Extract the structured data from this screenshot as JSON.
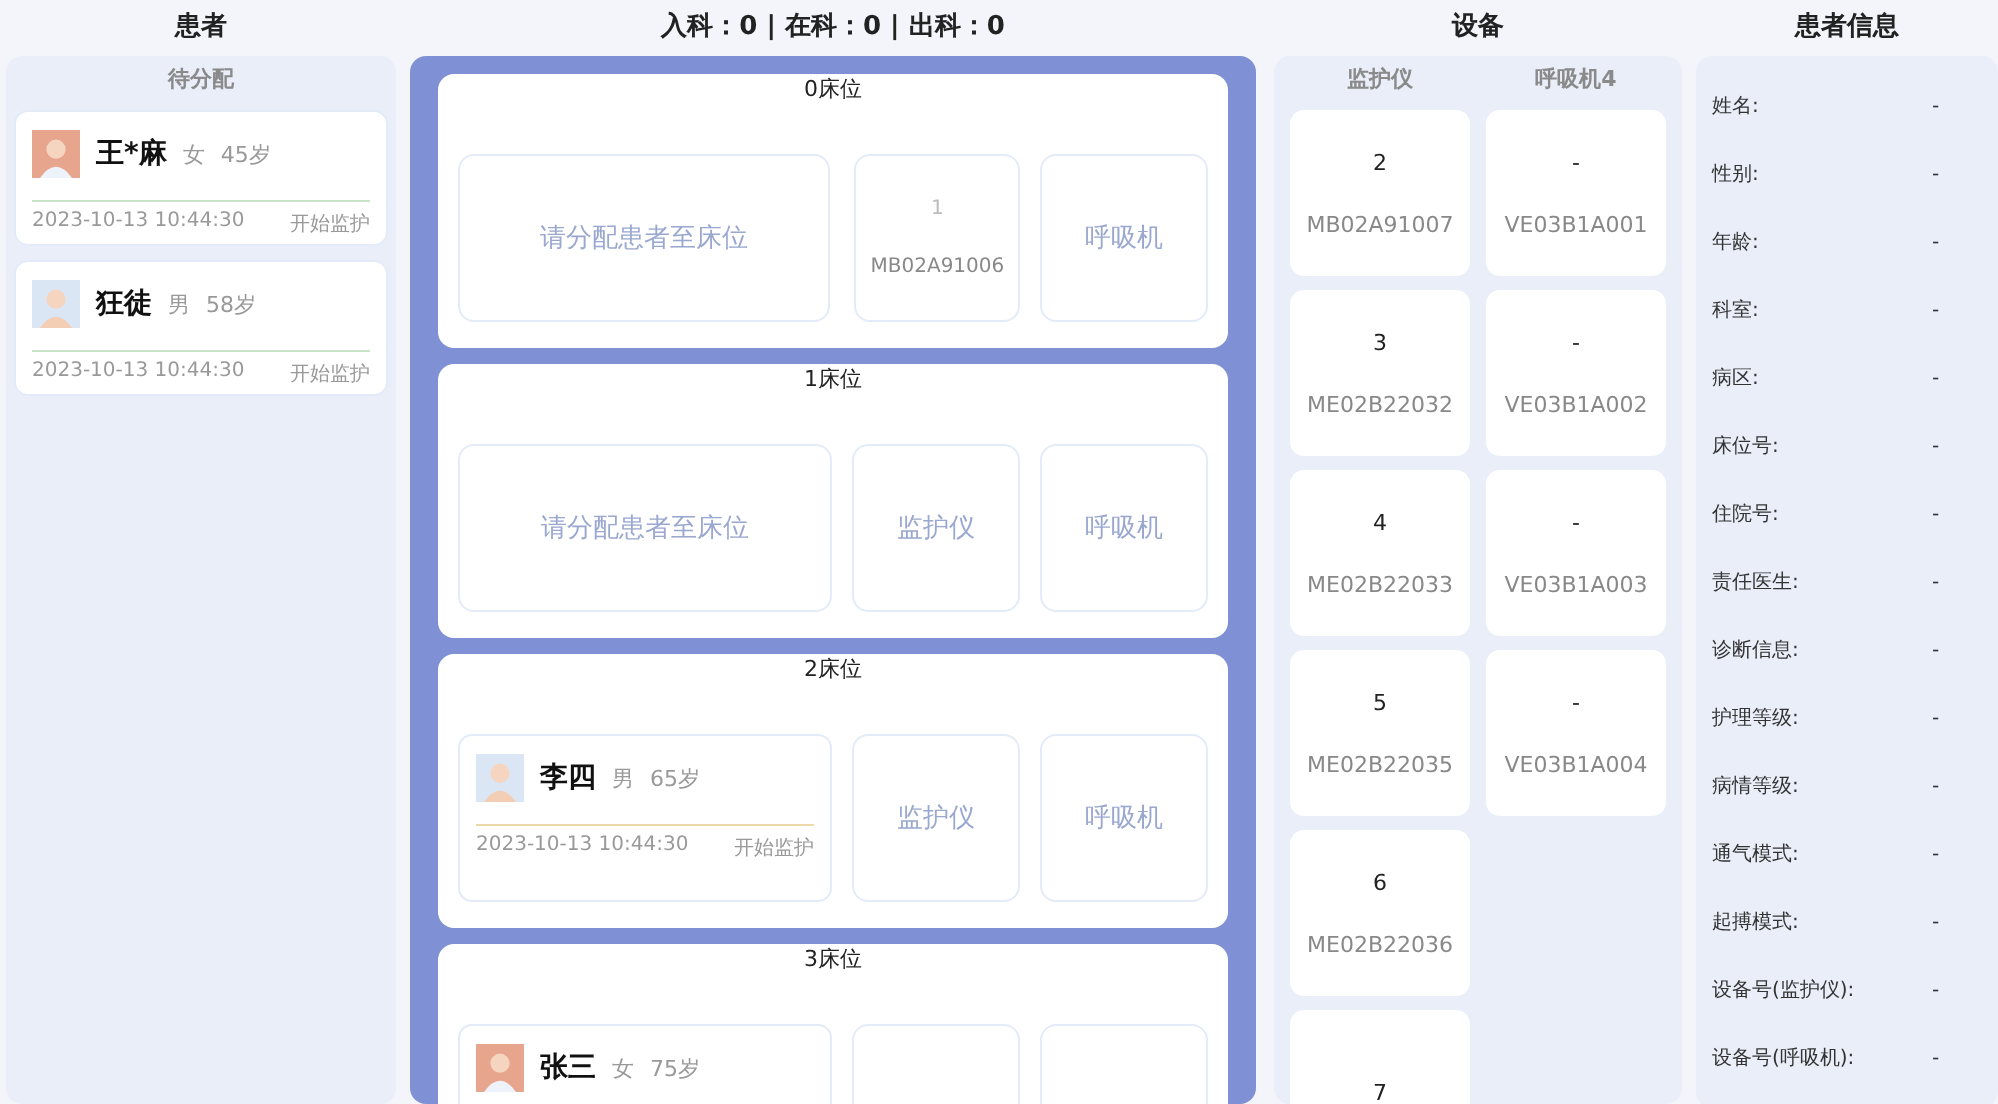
{
  "patients_panel": {
    "title": "患者",
    "subtitle": "待分配",
    "patients": [
      {
        "name": "王*麻",
        "gender": "女",
        "age": "45岁",
        "time": "2023-10-13 10:44:30",
        "action": "开始监护"
      },
      {
        "name": "狂徒",
        "gender": "男",
        "age": "58岁",
        "time": "2023-10-13 10:44:30",
        "action": "开始监护"
      }
    ]
  },
  "beds_panel": {
    "title": "入科：0 | 在科：0 | 出科：0",
    "beds": [
      {
        "label": "0床位",
        "patient": {
          "kind": "placeholder",
          "text": "请分配患者至床位"
        },
        "monitor": {
          "kind": "device",
          "number": "1",
          "serial": "MB02A91006"
        },
        "ventilator": {
          "kind": "empty",
          "text": "呼吸机"
        }
      },
      {
        "label": "1床位",
        "patient": {
          "kind": "placeholder",
          "text": "请分配患者至床位"
        },
        "monitor": {
          "kind": "empty",
          "text": "监护仪"
        },
        "ventilator": {
          "kind": "empty",
          "text": "呼吸机"
        }
      },
      {
        "label": "2床位",
        "patient": {
          "kind": "patient",
          "name": "李四",
          "gender": "男",
          "age": "65岁",
          "time": "2023-10-13 10:44:30",
          "action": "开始监护"
        },
        "monitor": {
          "kind": "empty",
          "text": "监护仪"
        },
        "ventilator": {
          "kind": "empty",
          "text": "呼吸机"
        }
      },
      {
        "label": "3床位",
        "patient": {
          "kind": "patient",
          "name": "张三",
          "gender": "女",
          "age": "75岁"
        },
        "monitor": {
          "kind": "blank"
        },
        "ventilator": {
          "kind": "blank"
        }
      }
    ]
  },
  "devices_panel": {
    "title": "设备",
    "columns": [
      "监护仪",
      "呼吸机4"
    ],
    "monitors": [
      {
        "number": "2",
        "serial": "MB02A91007"
      },
      {
        "number": "3",
        "serial": "ME02B22032"
      },
      {
        "number": "4",
        "serial": "ME02B22033"
      },
      {
        "number": "5",
        "serial": "ME02B22035"
      },
      {
        "number": "6",
        "serial": "ME02B22036"
      },
      {
        "number": "7"
      }
    ],
    "ventilators": [
      {
        "number": "-",
        "serial": "VE03B1A001"
      },
      {
        "number": "-",
        "serial": "VE03B1A002"
      },
      {
        "number": "-",
        "serial": "VE03B1A003"
      },
      {
        "number": "-",
        "serial": "VE03B1A004"
      }
    ]
  },
  "info_panel": {
    "title": "患者信息",
    "fields": [
      {
        "label": "姓名:",
        "value": "-"
      },
      {
        "label": "性别:",
        "value": "-"
      },
      {
        "label": "年龄:",
        "value": "-"
      },
      {
        "label": "科室:",
        "value": "-"
      },
      {
        "label": "病区:",
        "value": "-"
      },
      {
        "label": "床位号:",
        "value": "-"
      },
      {
        "label": "住院号:",
        "value": "-"
      },
      {
        "label": "责任医生:",
        "value": "-"
      },
      {
        "label": "诊断信息:",
        "value": "-"
      },
      {
        "label": "护理等级:",
        "value": "-"
      },
      {
        "label": "病情等级:",
        "value": "-"
      },
      {
        "label": "通气模式:",
        "value": "-"
      },
      {
        "label": "起搏模式:",
        "value": "-"
      },
      {
        "label": "设备号(监护仪):",
        "value": "-"
      },
      {
        "label": "设备号(呼吸机):",
        "value": "-"
      }
    ]
  }
}
